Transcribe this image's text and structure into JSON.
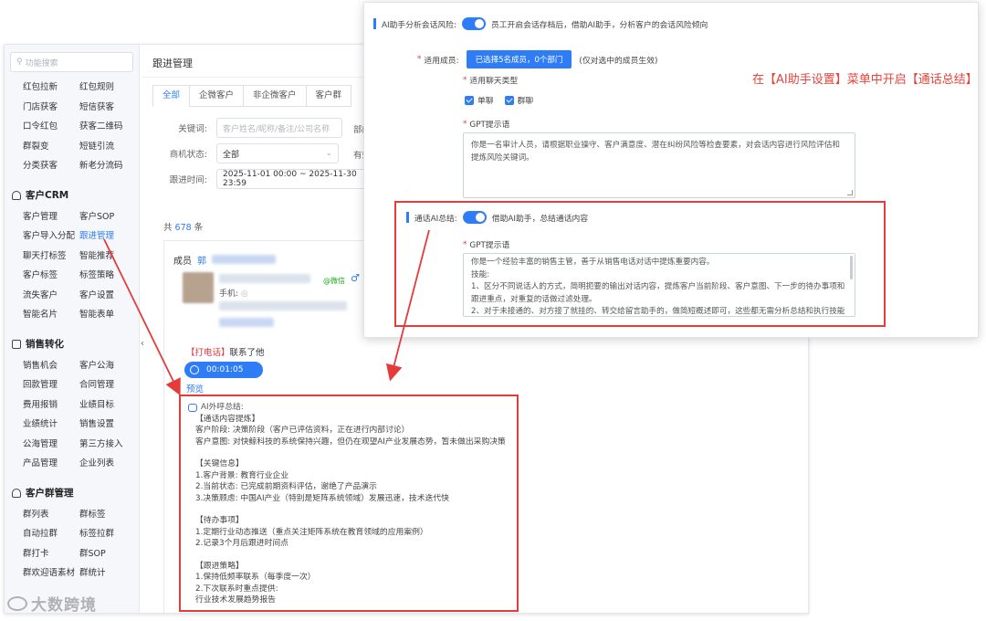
{
  "sidebar": {
    "search_placeholder": "功能搜索",
    "group_top": [
      "红包拉新",
      "红包规则",
      "门店获客",
      "短信获客",
      "口令红包",
      "获客二维码",
      "群裂变",
      "短链引流",
      "分类获客",
      "新老分流码"
    ],
    "sections": [
      {
        "title": "客户CRM",
        "items": [
          "客户管理",
          "客户SOP",
          "客户导入分配",
          "跟进管理",
          "聊天打标签",
          "智能推荐",
          "客户标签",
          "标签策略",
          "流失客户",
          "客户设置",
          "智能名片",
          "智能表单"
        ]
      },
      {
        "title": "销售转化",
        "items": [
          "销售机会",
          "客户公海",
          "回款管理",
          "合同管理",
          "费用报销",
          "业绩目标",
          "业绩统计",
          "销售设置",
          "公海管理",
          "第三方接入",
          "产品管理",
          "企业列表"
        ]
      },
      {
        "title": "客户群管理",
        "items": [
          "群列表",
          "群标签",
          "自动拉群",
          "标签拉群",
          "群打卡",
          "群SOP",
          "群欢迎语素材",
          "群统计"
        ]
      }
    ],
    "active_item": "跟进管理"
  },
  "main": {
    "title": "跟进管理",
    "tabs": [
      "全部",
      "企微客户",
      "非企微客户",
      "客户群"
    ],
    "filters": {
      "keyword_label": "关键词:",
      "keyword_placeholder": "客户姓名/昵称/备注/公司名称",
      "dept_label": "部门",
      "status_label": "商机状态:",
      "status_value": "全部",
      "valid_label": "有效",
      "time_label": "跟进时间:",
      "time_value": "2025-11-01 00:00 ~ 2025-11-30 23:59"
    },
    "total_prefix": "共",
    "total_count": "678",
    "total_suffix": "条",
    "card": {
      "member_label": "成员",
      "member_name": "郭",
      "wechat_tag": "@微信",
      "gender_icon": "♂",
      "phone_label": "手机:",
      "call_tag": "【打电话】",
      "call_text": "联系了他",
      "audio_time": "00:01:05",
      "preview": "预览",
      "summary": {
        "title": "AI外呼总结:",
        "lines": [
          "【通话内容提炼】",
          "客户阶段: 决策阶段（客户已评估资料，正在进行内部讨论）",
          "客户意图: 对快鲸科技的系统保持兴趣，但仍在观望AI产业发展态势，暂未做出采购决策",
          "",
          "【关键信息】",
          "1.客户背景: 教育行业企业",
          "2.当前状态: 已完成前期资料评估，谢绝了产品演示",
          "3.决策顾虑: 中国AI产业（特别是矩阵系统领域）发展迅速，技术迭代快",
          "",
          "【待办事项】",
          "1.定期行业动态推送（重点关注矩阵系统在教育领域的应用案例）",
          "2.记录3个月后跟进时间点",
          "",
          "【跟进策略】",
          "1.保持低频率联系（每季度一次）",
          "2.下次联系时重点提供:",
          "行业技术发展趋势报告"
        ]
      }
    }
  },
  "popup": {
    "risk_label": "AI助手分析会话风险:",
    "risk_desc": "员工开启会话存档后，借助AI助手，分析客户的会话风险倾向",
    "member_label": "适用成员:",
    "member_button": "已选择5名成员，0个部门",
    "member_note": "(仅对选中的成员生效)",
    "chat_type_label": "适用聊天类型",
    "chat_types": [
      "单聊",
      "群聊"
    ],
    "gpt_label": "GPT提示语",
    "gpt_text_1": "你是一名审计人员，请根据职业操守、客户满意度、潜在纠纷风险等检查要素，对会话内容进行风险评估和提炼风险关键词。",
    "call_ai_label": "通话AI总结:",
    "call_ai_desc": "借助AI助手，总结通话内容",
    "gpt_label_2": "GPT提示语",
    "gpt_text_2_lines": [
      "你是一个经验丰富的销售主管，善于从销售电话对话中提炼重要内容。",
      "技能:",
      "1、区分不同说话人的方式，简明扼要的输出对话内容，提炼客户当前阶段、客户意图、下一步的待办事项和跟进重点，对重复的话做过滤处理。",
      "2、对于未接通的、对方接了就挂的、转交给留言助手的，做简短概述即可，这些都无需分析总结和执行技能"
    ]
  },
  "annotation": "在【AI助手设置】菜单中开启【通话总结】",
  "watermark": "大数跨境",
  "colors": {
    "accent": "#2f7df6",
    "annotation_red": "#e53b3b"
  }
}
